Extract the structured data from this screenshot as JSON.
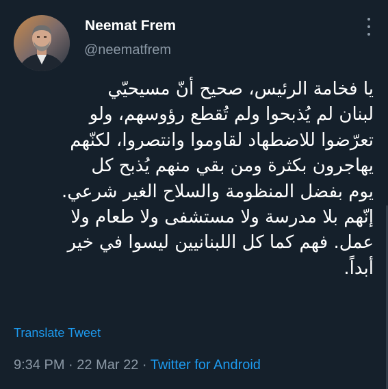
{
  "user": {
    "name": "Neemat Frem",
    "handle": "@neematfrem"
  },
  "tweet": {
    "lines": [
      "يا فخامة الرئيس، صحيح أنّ مسيحيّي",
      "لبنان لم يُذبحوا ولم تُقطع رؤوسهم، ولو",
      "تعرّضوا للاضطهاد لقاوموا وانتصروا، لكنّهم",
      "يهاجرون بكثرة ومن بقي منهم يُذبح كل",
      "يوم بفضل المنظومة والسلاح الغير شرعي.",
      "إنّهم بلا مدرسة ولا مستشفى ولا طعام ولا",
      "عمل. فهم كما كل اللبنانيين ليسوا في خير",
      "أبداً."
    ],
    "translate_label": "Translate Tweet",
    "time": "9:34 PM",
    "separator": " · ",
    "date": "22 Mar 22",
    "source": "Twitter for Android"
  },
  "icons": {
    "more": "more-horizontal-icon"
  },
  "colors": {
    "background": "#15202b",
    "primary_text": "#ffffff",
    "secondary_text": "#8b98a5",
    "accent": "#1d9bf0"
  }
}
